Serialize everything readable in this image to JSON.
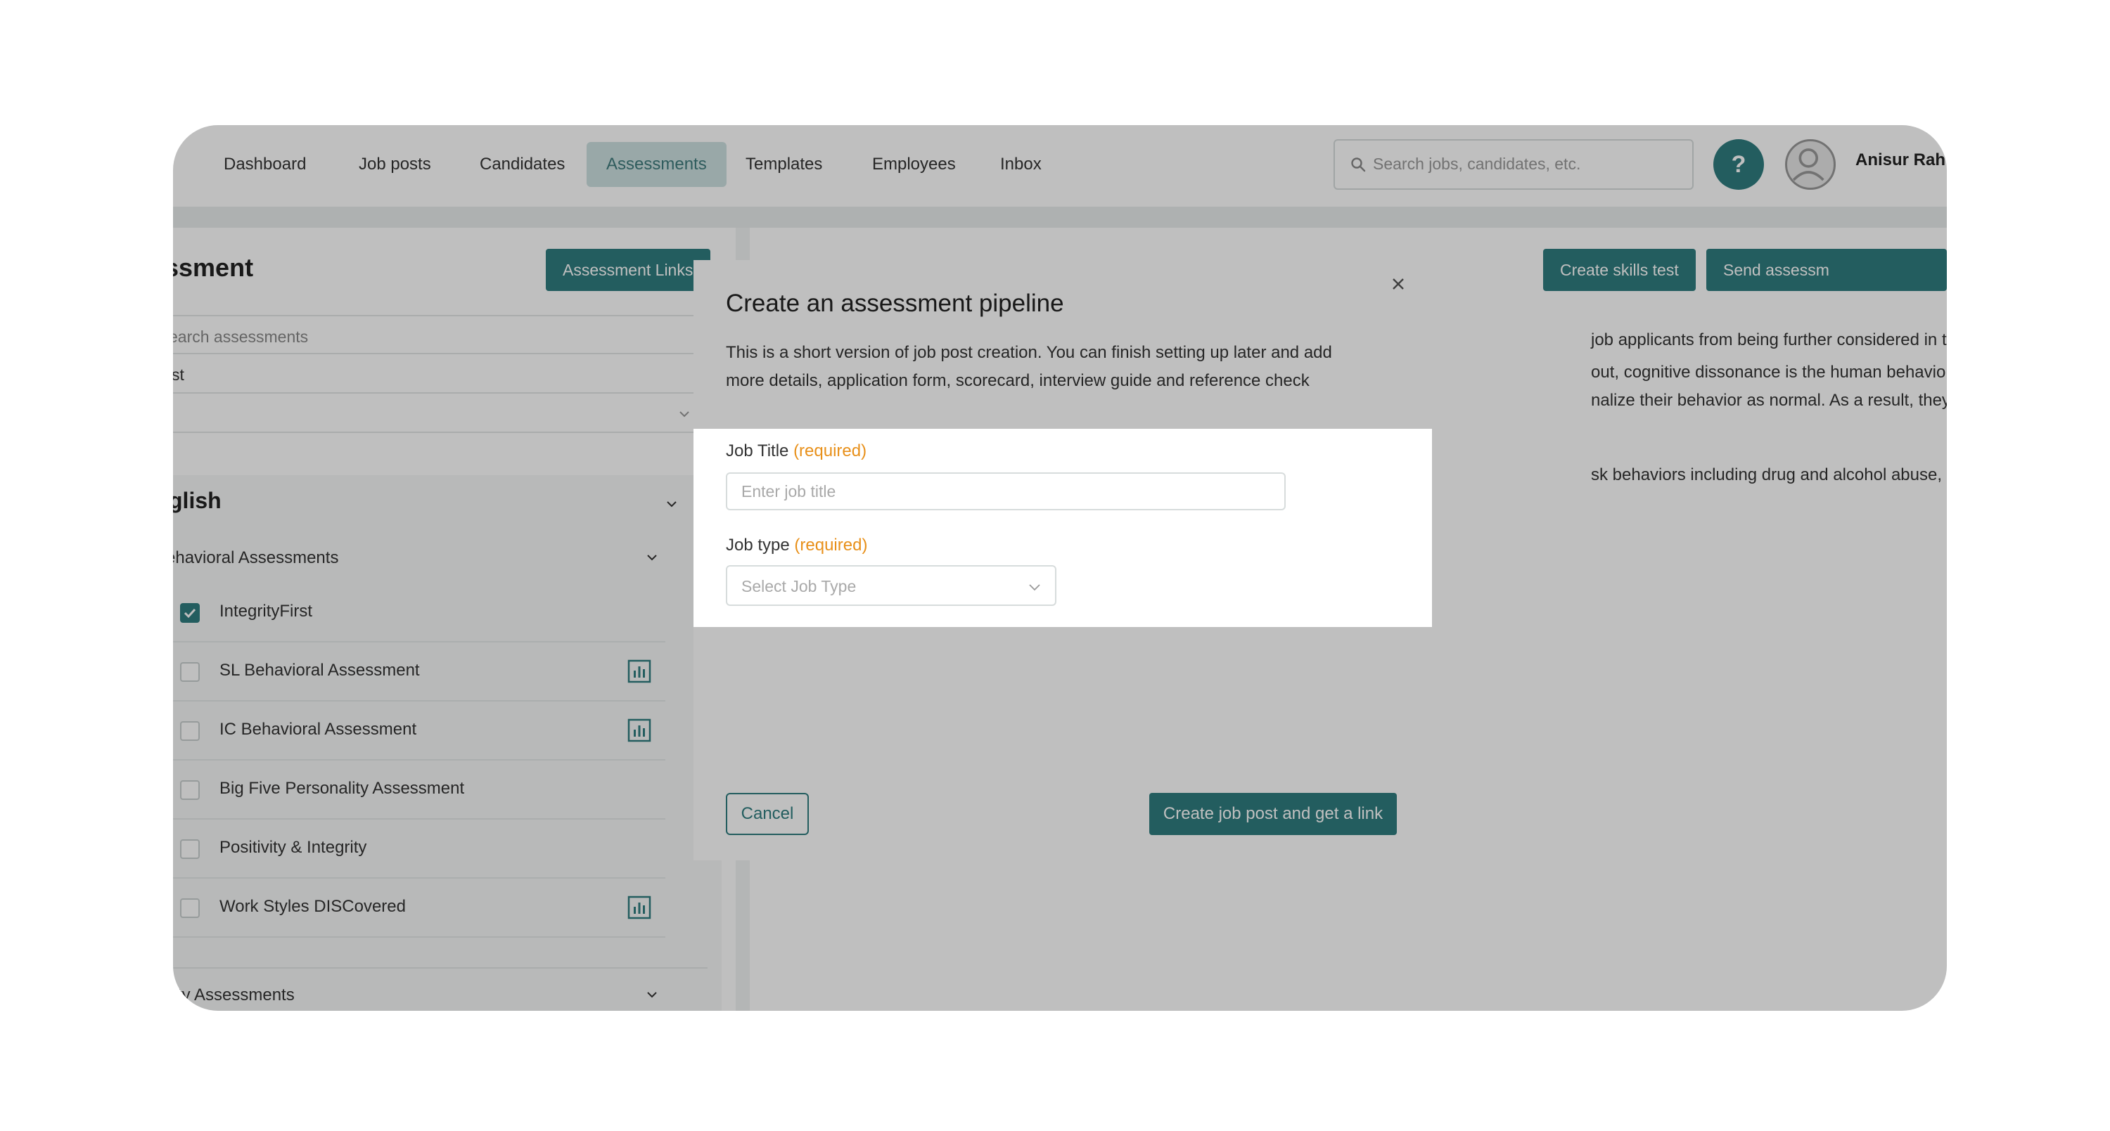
{
  "nav": {
    "items": [
      {
        "label": "Dashboard"
      },
      {
        "label": "Job posts"
      },
      {
        "label": "Candidates"
      },
      {
        "label": "Assessments",
        "active": true
      },
      {
        "label": "Templates"
      },
      {
        "label": "Employees"
      },
      {
        "label": "Inbox"
      }
    ],
    "search_placeholder": "Search jobs, candidates, etc.",
    "help_label": "?",
    "user_name": "Anisur Rahr"
  },
  "left_panel": {
    "title": "ssment",
    "assessment_links_label": "Assessment Links",
    "search_placeholder": "earch assessments",
    "filter_value": "st",
    "language_title": "glish",
    "category_behavioral": "ehavioral Assessments",
    "category_ability": "ility Assessments",
    "assessments": [
      {
        "label": "IntegrityFirst",
        "checked": true,
        "has_chart": false
      },
      {
        "label": "SL Behavioral Assessment",
        "checked": false,
        "has_chart": true
      },
      {
        "label": "IC Behavioral Assessment",
        "checked": false,
        "has_chart": true
      },
      {
        "label": "Big Five Personality Assessment",
        "checked": false,
        "has_chart": false
      },
      {
        "label": "Positivity & Integrity",
        "checked": false,
        "has_chart": false
      },
      {
        "label": "Work Styles DISCovered",
        "checked": false,
        "has_chart": true
      }
    ]
  },
  "right_panel": {
    "create_skills_label": "Create skills test",
    "send_assess_label": "Send assessm",
    "text_1": "job applicants from being further considered in the hiring process.",
    "text_2": "out, cognitive dissonance is the human behavior when candidates wh",
    "text_3": "nalize their behavior as normal. As a result, they have no issue with",
    "text_4": "sk behaviors including drug and alcohol abuse, theft, hostility or lying."
  },
  "modal": {
    "title": "Create an assessment pipeline",
    "description": "This is a short version of job post creation. You can finish setting up later and add more details, application form, scorecard, interview guide and reference check",
    "job_title_label": "Job Title",
    "job_type_label": "Job type",
    "required_text": "(required)",
    "job_title_placeholder": "Enter job title",
    "job_type_placeholder": "Select Job Type",
    "cancel_label": "Cancel",
    "create_label": "Create job post and get a link"
  },
  "colors": {
    "primary": "#2f7d7f",
    "required": "#e8901a"
  }
}
